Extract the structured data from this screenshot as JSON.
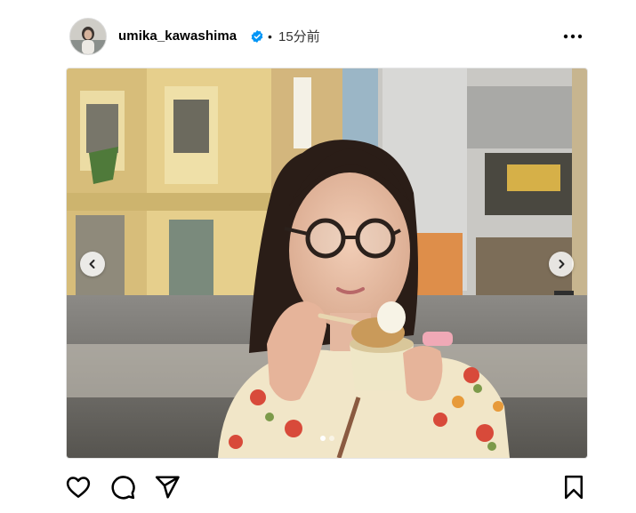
{
  "post": {
    "username": "umika_kawashima",
    "verified": true,
    "separator": "•",
    "time_ago": "15分前"
  },
  "media": {
    "slide_count": 2,
    "active_slide": 1,
    "prev_icon": "chevron-left-icon",
    "next_icon": "chevron-right-icon"
  },
  "actions": {
    "like_icon": "heart-icon",
    "comment_icon": "comment-icon",
    "share_icon": "send-icon",
    "save_icon": "bookmark-icon"
  },
  "colors": {
    "verified_badge": "#0095f6",
    "icon_stroke": "#000000"
  }
}
